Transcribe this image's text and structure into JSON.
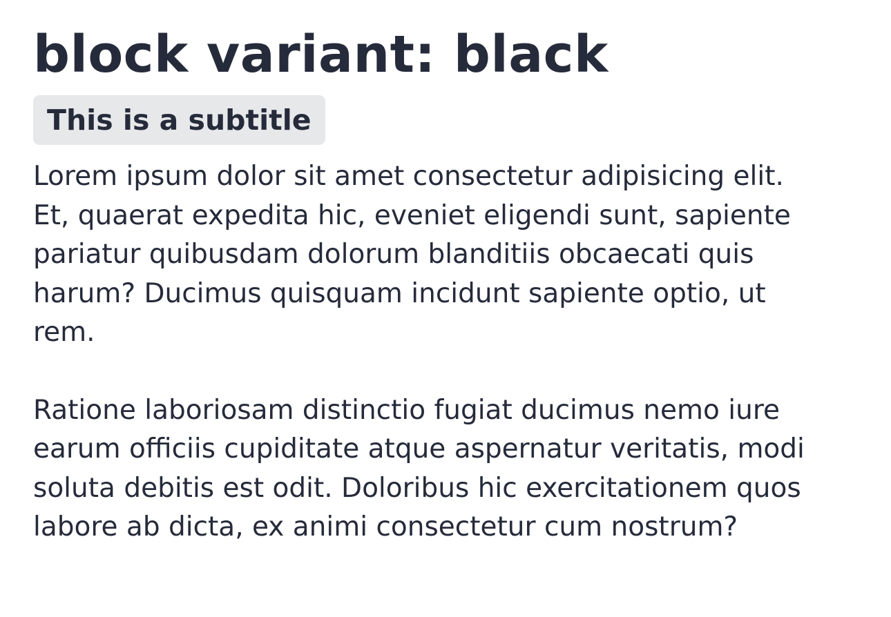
{
  "block": {
    "title": "block variant: black",
    "subtitle": "This is a subtitle",
    "paragraphs": [
      "Lorem ipsum dolor sit amet consectetur adipisicing elit. Et, quaerat expedita hic, eveniet eligendi sunt, sapiente pariatur quibusdam dolorum blanditiis obcaecati quis harum? Ducimus quisquam incidunt sapiente optio, ut rem.",
      "Ratione laboriosam distinctio fugiat ducimus nemo iure earum officiis cupiditate atque aspernatur veritatis, modi soluta debitis est odit. Doloribus hic exercitationem quos labore ab dicta, ex animi consectetur cum nostrum?"
    ]
  },
  "colors": {
    "text": "#262b3b",
    "subtitle_background": "#e7e8ea",
    "page_background": "#ffffff"
  }
}
